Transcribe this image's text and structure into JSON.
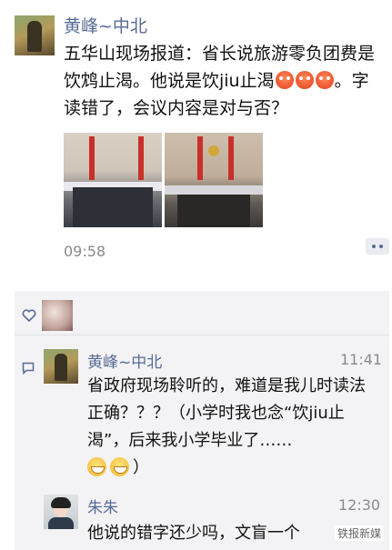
{
  "post": {
    "author": "黄峰~中北",
    "text_before_emoji": "五华山现场报道：省长说旅游零负团费是饮鸩止渴。他说是饮jiu止渴",
    "text_after_emoji": "。字读错了，会议内容是对与否？",
    "time": "09:58",
    "emoji_name": "angry-face-emoji"
  },
  "comments": [
    {
      "name": "黄峰~中北",
      "time": "11:41",
      "text": "省政府现场聆听的，难道是我儿时读法正确？？？（小学时我也念“饮jiu止渴”，后来我小学毕业了……",
      "trailing": "）"
    },
    {
      "name": "朱朱",
      "time": "12:30",
      "text": "他说的错字还少吗，文盲一个"
    }
  ],
  "watermark": "铁报新媒",
  "colors": {
    "link": "#576b95",
    "comment_bg": "#f3f3f5",
    "time": "#8a8a8a"
  }
}
